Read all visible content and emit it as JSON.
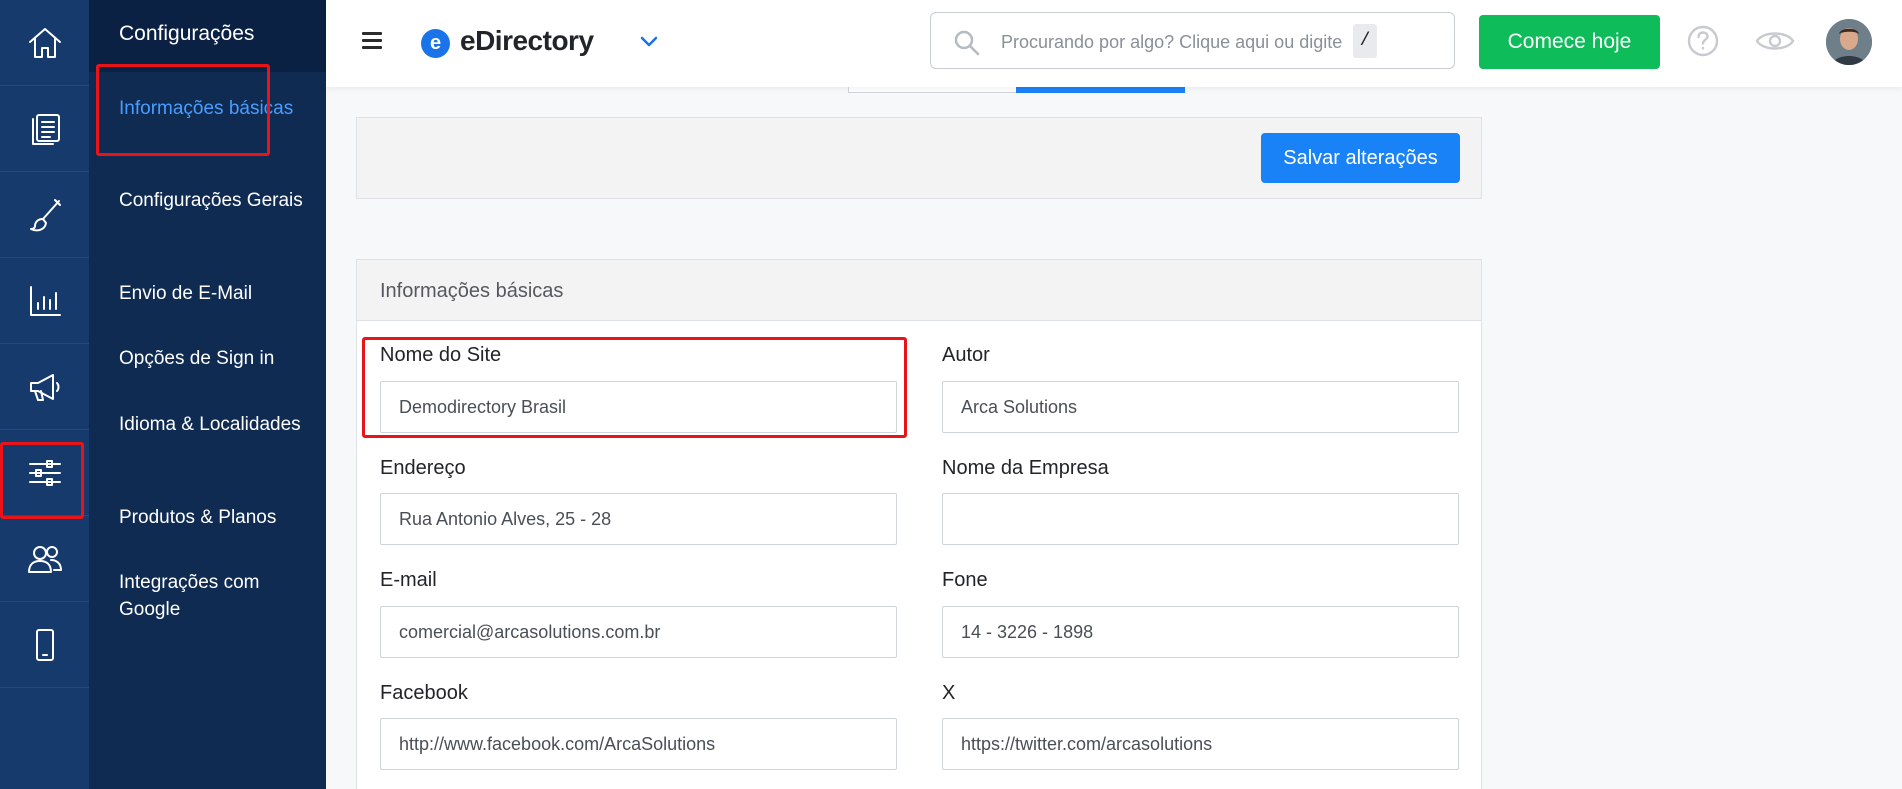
{
  "rail": {
    "items": [
      {
        "icon": "home-icon"
      },
      {
        "icon": "content-icon"
      },
      {
        "icon": "design-brush-icon"
      },
      {
        "icon": "reports-chart-icon"
      },
      {
        "icon": "promotion-megaphone-icon"
      },
      {
        "icon": "settings-sliders-icon"
      },
      {
        "icon": "users-icon"
      },
      {
        "icon": "mobile-icon"
      }
    ]
  },
  "submenu": {
    "title": "Configurações",
    "items": [
      {
        "label": "Informações básicas"
      },
      {
        "label": "Configurações Gerais"
      },
      {
        "label": "Envio de E-Mail"
      },
      {
        "label": "Opções de Sign in"
      },
      {
        "label": "Idioma & Localidades"
      },
      {
        "label": "Produtos & Planos"
      },
      {
        "label": "Integrações com Google"
      }
    ]
  },
  "topbar": {
    "logo_mark": "e",
    "logo_text": "eDirectory",
    "search_placeholder": "Procurando por algo? Clique aqui ou digite",
    "search_shortcut": "/",
    "cta_label": "Comece hoje"
  },
  "content": {
    "save_label": "Salvar alterações",
    "section_title": "Informações básicas",
    "fields": {
      "site_name": {
        "label": "Nome do Site",
        "value": "Demodirectory Brasil"
      },
      "author": {
        "label": "Autor",
        "value": "Arca Solutions"
      },
      "address": {
        "label": "Endereço",
        "value": "Rua Antonio Alves, 25 - 28"
      },
      "company": {
        "label": "Nome da Empresa",
        "value": ""
      },
      "email": {
        "label": "E-mail",
        "value": "comercial@arcasolutions.com.br"
      },
      "phone": {
        "label": "Fone",
        "value": "14 - 3226 - 1898"
      },
      "facebook": {
        "label": "Facebook",
        "value": "http://www.facebook.com/ArcaSolutions"
      },
      "x": {
        "label": "X",
        "value": "https://twitter.com/arcasolutions"
      }
    }
  },
  "colors": {
    "rail_bg": "#173a6c",
    "submenu_bg": "#0f2b52",
    "active_link": "#4a9dff",
    "primary": "#1a82f7",
    "cta": "#0fbc5a",
    "highlight": "#e8141a"
  }
}
